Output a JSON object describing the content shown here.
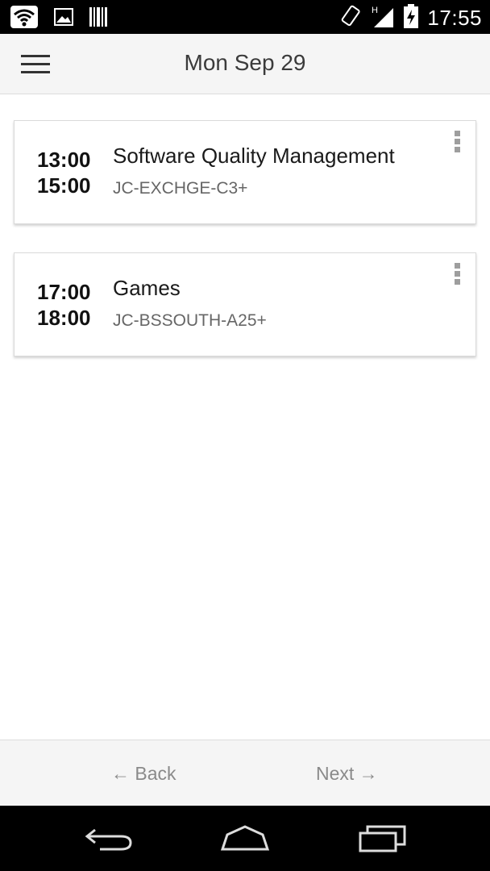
{
  "status_bar": {
    "time": "17:55",
    "left_icons": [
      "wifi-icon",
      "image-icon",
      "barcode-icon"
    ],
    "right_icons": [
      "rotate-icon",
      "signal-icon",
      "battery-charging-icon"
    ]
  },
  "app_bar": {
    "title": "Mon Sep 29",
    "menu_icon": "hamburger-menu-icon"
  },
  "events": [
    {
      "start": "13:00",
      "end": "15:00",
      "name": "Software Quality Management",
      "room": "JC-EXCHGE-C3+"
    },
    {
      "start": "17:00",
      "end": "18:00",
      "name": "Games",
      "room": "JC-BSSOUTH-A25+"
    }
  ],
  "bottom_nav": {
    "back_label": "← Back",
    "next_label": "Next →"
  },
  "system_nav": [
    "back-icon",
    "home-icon",
    "recents-icon"
  ],
  "colors": {
    "status_bar": "#000000",
    "app_bar": "#f5f5f5",
    "card_border": "#dadada",
    "room_text": "#666666",
    "nav_text": "#8a8a8a"
  }
}
